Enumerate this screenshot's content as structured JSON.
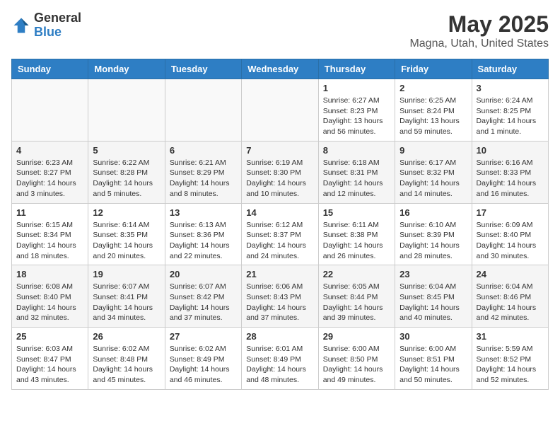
{
  "header": {
    "logo_general": "General",
    "logo_blue": "Blue",
    "main_title": "May 2025",
    "subtitle": "Magna, Utah, United States"
  },
  "weekdays": [
    "Sunday",
    "Monday",
    "Tuesday",
    "Wednesday",
    "Thursday",
    "Friday",
    "Saturday"
  ],
  "weeks": [
    [
      {
        "day": "",
        "info": ""
      },
      {
        "day": "",
        "info": ""
      },
      {
        "day": "",
        "info": ""
      },
      {
        "day": "",
        "info": ""
      },
      {
        "day": "1",
        "info": "Sunrise: 6:27 AM\nSunset: 8:23 PM\nDaylight: 13 hours and 56 minutes."
      },
      {
        "day": "2",
        "info": "Sunrise: 6:25 AM\nSunset: 8:24 PM\nDaylight: 13 hours and 59 minutes."
      },
      {
        "day": "3",
        "info": "Sunrise: 6:24 AM\nSunset: 8:25 PM\nDaylight: 14 hours and 1 minute."
      }
    ],
    [
      {
        "day": "4",
        "info": "Sunrise: 6:23 AM\nSunset: 8:27 PM\nDaylight: 14 hours and 3 minutes."
      },
      {
        "day": "5",
        "info": "Sunrise: 6:22 AM\nSunset: 8:28 PM\nDaylight: 14 hours and 5 minutes."
      },
      {
        "day": "6",
        "info": "Sunrise: 6:21 AM\nSunset: 8:29 PM\nDaylight: 14 hours and 8 minutes."
      },
      {
        "day": "7",
        "info": "Sunrise: 6:19 AM\nSunset: 8:30 PM\nDaylight: 14 hours and 10 minutes."
      },
      {
        "day": "8",
        "info": "Sunrise: 6:18 AM\nSunset: 8:31 PM\nDaylight: 14 hours and 12 minutes."
      },
      {
        "day": "9",
        "info": "Sunrise: 6:17 AM\nSunset: 8:32 PM\nDaylight: 14 hours and 14 minutes."
      },
      {
        "day": "10",
        "info": "Sunrise: 6:16 AM\nSunset: 8:33 PM\nDaylight: 14 hours and 16 minutes."
      }
    ],
    [
      {
        "day": "11",
        "info": "Sunrise: 6:15 AM\nSunset: 8:34 PM\nDaylight: 14 hours and 18 minutes."
      },
      {
        "day": "12",
        "info": "Sunrise: 6:14 AM\nSunset: 8:35 PM\nDaylight: 14 hours and 20 minutes."
      },
      {
        "day": "13",
        "info": "Sunrise: 6:13 AM\nSunset: 8:36 PM\nDaylight: 14 hours and 22 minutes."
      },
      {
        "day": "14",
        "info": "Sunrise: 6:12 AM\nSunset: 8:37 PM\nDaylight: 14 hours and 24 minutes."
      },
      {
        "day": "15",
        "info": "Sunrise: 6:11 AM\nSunset: 8:38 PM\nDaylight: 14 hours and 26 minutes."
      },
      {
        "day": "16",
        "info": "Sunrise: 6:10 AM\nSunset: 8:39 PM\nDaylight: 14 hours and 28 minutes."
      },
      {
        "day": "17",
        "info": "Sunrise: 6:09 AM\nSunset: 8:40 PM\nDaylight: 14 hours and 30 minutes."
      }
    ],
    [
      {
        "day": "18",
        "info": "Sunrise: 6:08 AM\nSunset: 8:40 PM\nDaylight: 14 hours and 32 minutes."
      },
      {
        "day": "19",
        "info": "Sunrise: 6:07 AM\nSunset: 8:41 PM\nDaylight: 14 hours and 34 minutes."
      },
      {
        "day": "20",
        "info": "Sunrise: 6:07 AM\nSunset: 8:42 PM\nDaylight: 14 hours and 37 minutes."
      },
      {
        "day": "21",
        "info": "Sunrise: 6:06 AM\nSunset: 8:43 PM\nDaylight: 14 hours and 37 minutes."
      },
      {
        "day": "22",
        "info": "Sunrise: 6:05 AM\nSunset: 8:44 PM\nDaylight: 14 hours and 39 minutes."
      },
      {
        "day": "23",
        "info": "Sunrise: 6:04 AM\nSunset: 8:45 PM\nDaylight: 14 hours and 40 minutes."
      },
      {
        "day": "24",
        "info": "Sunrise: 6:04 AM\nSunset: 8:46 PM\nDaylight: 14 hours and 42 minutes."
      }
    ],
    [
      {
        "day": "25",
        "info": "Sunrise: 6:03 AM\nSunset: 8:47 PM\nDaylight: 14 hours and 43 minutes."
      },
      {
        "day": "26",
        "info": "Sunrise: 6:02 AM\nSunset: 8:48 PM\nDaylight: 14 hours and 45 minutes."
      },
      {
        "day": "27",
        "info": "Sunrise: 6:02 AM\nSunset: 8:49 PM\nDaylight: 14 hours and 46 minutes."
      },
      {
        "day": "28",
        "info": "Sunrise: 6:01 AM\nSunset: 8:49 PM\nDaylight: 14 hours and 48 minutes."
      },
      {
        "day": "29",
        "info": "Sunrise: 6:00 AM\nSunset: 8:50 PM\nDaylight: 14 hours and 49 minutes."
      },
      {
        "day": "30",
        "info": "Sunrise: 6:00 AM\nSunset: 8:51 PM\nDaylight: 14 hours and 50 minutes."
      },
      {
        "day": "31",
        "info": "Sunrise: 5:59 AM\nSunset: 8:52 PM\nDaylight: 14 hours and 52 minutes."
      }
    ]
  ]
}
